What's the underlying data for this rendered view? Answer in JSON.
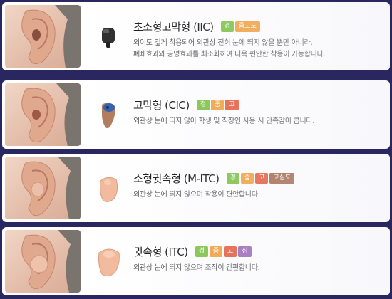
{
  "colors": {
    "background": "#2a2660",
    "badge_green": "#7cc242",
    "badge_orange": "#f2a03d",
    "badge_red": "#e55a3c",
    "badge_brown": "#a0674a",
    "badge_purple": "#9a67b7"
  },
  "items": [
    {
      "title": "초소형고막형 (IIC)",
      "badges": [
        {
          "label": "경",
          "color": "#7cc242"
        },
        {
          "label": "중고도",
          "color": "#f2a03d"
        }
      ],
      "desc": [
        "외이도 깊게 착용되어 외관상 전혀 눈에 띄지 않을 뿐만 아니라,",
        "폐쇄효과와 공명효과를 최소화하여 더욱 편안한 착용이 가능합니다."
      ],
      "device_icon": "iic-hearing-aid-icon"
    },
    {
      "title": "고막형 (CIC)",
      "badges": [
        {
          "label": "경",
          "color": "#7cc242"
        },
        {
          "label": "중",
          "color": "#f2a03d"
        },
        {
          "label": "고",
          "color": "#e55a3c"
        }
      ],
      "desc": [
        "외관상 눈에 띄지 않아 학생 및 직장인 사용 시 만족감이 큽니다."
      ],
      "device_icon": "cic-hearing-aid-icon"
    },
    {
      "title": "소형귓속형 (M-ITC)",
      "badges": [
        {
          "label": "경",
          "color": "#7cc242"
        },
        {
          "label": "중",
          "color": "#f2a03d"
        },
        {
          "label": "고",
          "color": "#e55a3c"
        },
        {
          "label": "고심도",
          "color": "#a0674a"
        }
      ],
      "desc": [
        "외관상 눈에 띄지 않으며 착용이 편안합니다."
      ],
      "device_icon": "mitc-hearing-aid-icon"
    },
    {
      "title": "귓속형 (ITC)",
      "badges": [
        {
          "label": "경",
          "color": "#7cc242"
        },
        {
          "label": "중",
          "color": "#f2a03d"
        },
        {
          "label": "고",
          "color": "#e55a3c"
        },
        {
          "label": "심",
          "color": "#9a67b7"
        }
      ],
      "desc": [
        "외관상 눈에 띄지 않으며 조작이 간편합니다."
      ],
      "device_icon": "itc-hearing-aid-icon"
    }
  ]
}
